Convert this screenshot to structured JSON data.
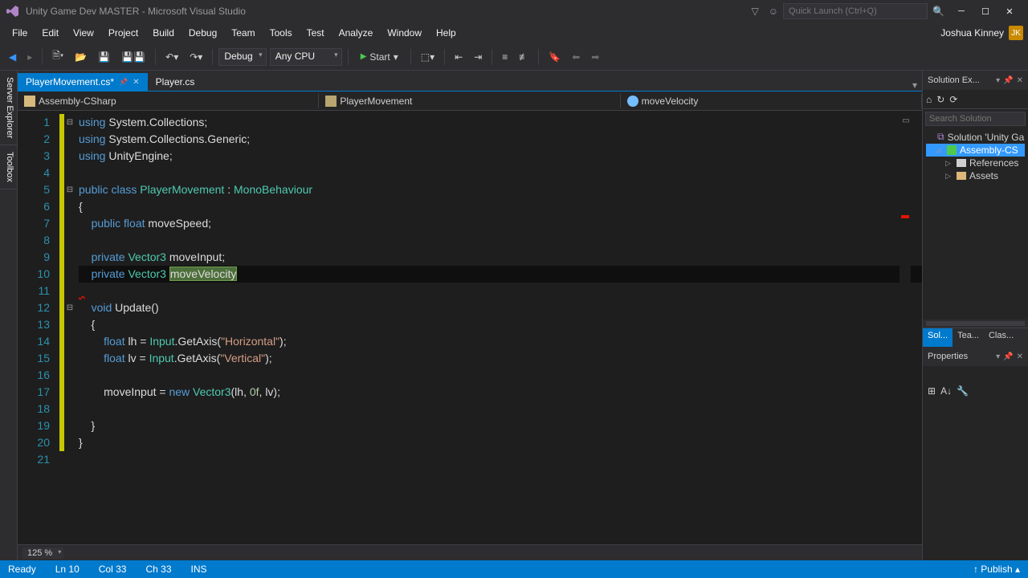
{
  "titlebar": {
    "title": "Unity Game Dev MASTER - Microsoft Visual Studio",
    "quick_launch_placeholder": "Quick Launch (Ctrl+Q)"
  },
  "menubar": {
    "items": [
      "File",
      "Edit",
      "View",
      "Project",
      "Build",
      "Debug",
      "Team",
      "Tools",
      "Test",
      "Analyze",
      "Window",
      "Help"
    ],
    "user": "Joshua Kinney",
    "user_initials": "JK"
  },
  "toolbar": {
    "config": "Debug",
    "platform": "Any CPU",
    "start": "Start"
  },
  "tabs": {
    "items": [
      {
        "label": "PlayerMovement.cs*",
        "active": true,
        "pinned": true
      },
      {
        "label": "Player.cs",
        "active": false,
        "pinned": false
      }
    ]
  },
  "navbar": {
    "scope": "Assembly-CSharp",
    "class": "PlayerMovement",
    "member": "moveVelocity"
  },
  "code": {
    "lines": [
      {
        "n": 1,
        "cb": "mod",
        "ol": "⊟",
        "tokens": [
          [
            "kw",
            "using"
          ],
          [
            "",
            " System.Collections;"
          ]
        ]
      },
      {
        "n": 2,
        "cb": "mod",
        "ol": "",
        "tokens": [
          [
            "kw",
            "using"
          ],
          [
            "",
            " System.Collections.Generic;"
          ]
        ]
      },
      {
        "n": 3,
        "cb": "mod",
        "ol": "",
        "tokens": [
          [
            "kw",
            "using"
          ],
          [
            "",
            " UnityEngine;"
          ]
        ]
      },
      {
        "n": 4,
        "cb": "mod",
        "ol": "",
        "tokens": [
          [
            "",
            ""
          ]
        ]
      },
      {
        "n": 5,
        "cb": "mod",
        "ol": "⊟",
        "tokens": [
          [
            "kw",
            "public"
          ],
          [
            "",
            " "
          ],
          [
            "kw",
            "class"
          ],
          [
            "",
            " "
          ],
          [
            "type",
            "PlayerMovement"
          ],
          [
            "",
            " : "
          ],
          [
            "type",
            "MonoBehaviour"
          ]
        ]
      },
      {
        "n": 6,
        "cb": "mod",
        "ol": "",
        "tokens": [
          [
            "",
            "{"
          ]
        ]
      },
      {
        "n": 7,
        "cb": "mod",
        "ol": "",
        "tokens": [
          [
            "",
            "    "
          ],
          [
            "kw",
            "public"
          ],
          [
            "",
            " "
          ],
          [
            "kw",
            "float"
          ],
          [
            "",
            " moveSpeed;"
          ]
        ]
      },
      {
        "n": 8,
        "cb": "mod",
        "ol": "",
        "tokens": [
          [
            "",
            ""
          ]
        ]
      },
      {
        "n": 9,
        "cb": "mod",
        "ol": "",
        "tokens": [
          [
            "",
            "    "
          ],
          [
            "kw",
            "private"
          ],
          [
            "",
            " "
          ],
          [
            "type",
            "Vector3"
          ],
          [
            "",
            " moveInput;"
          ]
        ]
      },
      {
        "n": 10,
        "cb": "mod",
        "ol": "",
        "current": true,
        "tokens": [
          [
            "",
            "    "
          ],
          [
            "kw",
            "private"
          ],
          [
            "",
            " "
          ],
          [
            "type",
            "Vector3"
          ],
          [
            "",
            " "
          ],
          [
            "hl",
            "moveVelocity"
          ]
        ]
      },
      {
        "n": 11,
        "cb": "mod",
        "ol": "",
        "tokens": [
          [
            "sq",
            "  "
          ]
        ]
      },
      {
        "n": 12,
        "cb": "mod",
        "ol": "⊟",
        "tokens": [
          [
            "",
            "    "
          ],
          [
            "kw",
            "void"
          ],
          [
            "",
            " Update()"
          ]
        ]
      },
      {
        "n": 13,
        "cb": "mod",
        "ol": "",
        "tokens": [
          [
            "",
            "    {"
          ]
        ]
      },
      {
        "n": 14,
        "cb": "mod",
        "ol": "",
        "tokens": [
          [
            "",
            "        "
          ],
          [
            "kw",
            "float"
          ],
          [
            "",
            " lh = "
          ],
          [
            "type",
            "Input"
          ],
          [
            "",
            ".GetAxis("
          ],
          [
            "str",
            "\"Horizontal\""
          ],
          [
            "",
            ");"
          ]
        ]
      },
      {
        "n": 15,
        "cb": "mod",
        "ol": "",
        "tokens": [
          [
            "",
            "        "
          ],
          [
            "kw",
            "float"
          ],
          [
            "",
            " lv = "
          ],
          [
            "type",
            "Input"
          ],
          [
            "",
            ".GetAxis("
          ],
          [
            "str",
            "\"Vertical\""
          ],
          [
            "",
            ");"
          ]
        ]
      },
      {
        "n": 16,
        "cb": "mod",
        "ol": "",
        "tokens": [
          [
            "",
            ""
          ]
        ]
      },
      {
        "n": 17,
        "cb": "mod",
        "ol": "",
        "tokens": [
          [
            "",
            "        moveInput = "
          ],
          [
            "kw",
            "new"
          ],
          [
            "",
            " "
          ],
          [
            "type",
            "Vector3"
          ],
          [
            "",
            "(lh, "
          ],
          [
            "num",
            "0f"
          ],
          [
            "",
            ", lv);"
          ]
        ]
      },
      {
        "n": 18,
        "cb": "mod",
        "ol": "",
        "tokens": [
          [
            "",
            ""
          ]
        ]
      },
      {
        "n": 19,
        "cb": "mod",
        "ol": "",
        "tokens": [
          [
            "",
            "    }"
          ]
        ]
      },
      {
        "n": 20,
        "cb": "mod",
        "ol": "",
        "tokens": [
          [
            "",
            "}"
          ]
        ]
      },
      {
        "n": 21,
        "cb": "",
        "ol": "",
        "tokens": [
          [
            "",
            ""
          ]
        ]
      }
    ]
  },
  "zoom": "125 %",
  "sidetabs_left": [
    "Server Explorer",
    "Toolbox"
  ],
  "solution_explorer": {
    "title": "Solution Ex...",
    "search_placeholder": "Search Solution",
    "nodes": [
      {
        "label": "Solution 'Unity Ga",
        "indent": 0,
        "icon": "sol",
        "expander": ""
      },
      {
        "label": "Assembly-CS",
        "indent": 1,
        "icon": "cs",
        "expander": "⊿",
        "selected": true
      },
      {
        "label": "References",
        "indent": 2,
        "icon": "refs",
        "expander": "▷"
      },
      {
        "label": "Assets",
        "indent": 2,
        "icon": "folder",
        "expander": "▷"
      }
    ],
    "bottom_tabs": [
      "Sol...",
      "Tea...",
      "Clas..."
    ]
  },
  "properties": {
    "title": "Properties"
  },
  "statusbar": {
    "ready": "Ready",
    "ln_label": "Ln",
    "ln": "10",
    "col_label": "Col",
    "col": "33",
    "ch_label": "Ch",
    "ch": "33",
    "ins": "INS",
    "publish": "Publish"
  }
}
